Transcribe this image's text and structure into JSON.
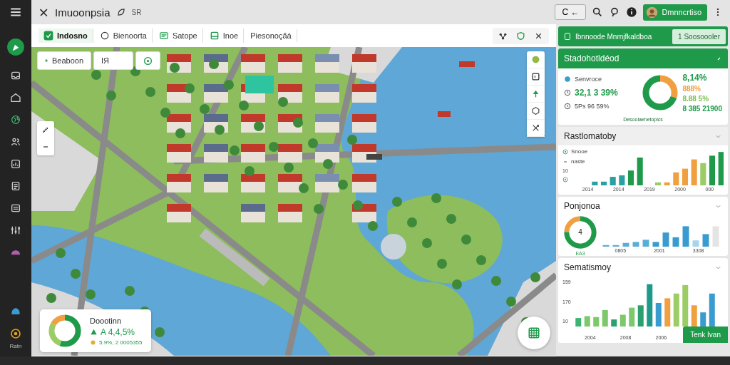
{
  "topbar": {
    "title": "Imuoonpsia",
    "subtitle": "SR",
    "center_button": "C ←",
    "user_button": "Dmnncrtiso"
  },
  "sidebar": {
    "footer_label": "Ratn"
  },
  "toolbar": {
    "tabs": [
      {
        "label": "Indosno",
        "selected": true
      },
      {
        "label": "Bienoorta",
        "selected": false
      },
      {
        "label": "Satope",
        "selected": false
      },
      {
        "label": "Inoe",
        "selected": false
      },
      {
        "label": "Piesonoçãá",
        "selected": false
      }
    ]
  },
  "map": {
    "chips": [
      "Beaboon",
      "IЯ"
    ],
    "stat_card": {
      "title": "Doootinn",
      "value": "A 4,4,5%",
      "note": "5.9%, 2 0005355"
    }
  },
  "panel": {
    "header": {
      "title": "Ibnnoode Mnrnjfkaldboa",
      "button": "1 Soosoooler"
    },
    "summary": {
      "title": "Stadohotldéod",
      "items": [
        {
          "kind": "dot",
          "text": "Senvroce"
        },
        {
          "kind": "value",
          "text": "32,1 3 39%"
        },
        {
          "kind": "clock",
          "text": "5Ps 96 59%"
        }
      ],
      "figures": [
        {
          "text": "8,14%",
          "color": "#1e9a4a"
        },
        {
          "text": "888%",
          "color": "#f0a040"
        },
        {
          "text": "8.88 5%",
          "color": "#7cbf4e"
        },
        {
          "text": "8 385 21900",
          "color": "#1e9a4a"
        }
      ],
      "caption": "Desoolaehetopics"
    },
    "sections": [
      {
        "title": "Rastlomatoby",
        "expanded": true,
        "legend": [
          "Snooe",
          "naste"
        ],
        "y_labels": [
          "10"
        ],
        "x_labels": [
          "2014",
          "2014",
          "2019",
          "2000",
          "000"
        ]
      },
      {
        "title": "Ponjonoa",
        "expanded": true,
        "donut_center": "4",
        "donut_label": "EA3",
        "x_labels": [
          "0805",
          "2001",
          "3308"
        ]
      },
      {
        "title": "Sematismoy",
        "expanded": true,
        "y_labels": [
          "159",
          "170",
          "10"
        ],
        "x_labels": [
          "2004",
          "2008",
          "2006"
        ],
        "button": "Tenk Ivan"
      }
    ]
  }
}
